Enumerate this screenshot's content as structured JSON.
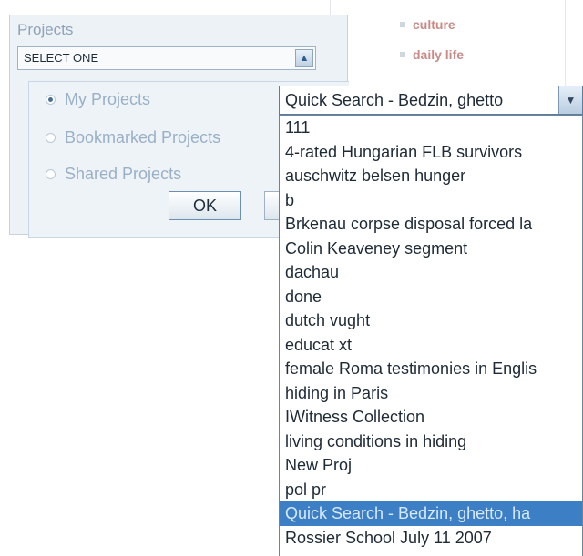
{
  "panel": {
    "title": "Projects",
    "select_label": "SELECT ONE",
    "radios": [
      {
        "label": "My Projects",
        "checked": true
      },
      {
        "label": "Bookmarked Projects",
        "checked": false
      },
      {
        "label": "Shared Projects",
        "checked": false
      }
    ],
    "ok_label": "OK"
  },
  "tags": [
    "culture",
    "daily life"
  ],
  "dropdown": {
    "selected": "Quick Search - Bedzin, ghetto",
    "options": [
      "111",
      "4-rated Hungarian FLB survivors",
      "auschwitz belsen hunger",
      "b",
      "Brkenau corpse disposal forced la",
      "Colin Keaveney segment",
      "dachau",
      "done",
      "dutch vught",
      "educat xt",
      "female Roma testimonies in Englis",
      "hiding in Paris",
      "IWitness Collection",
      "living conditions in hiding",
      "New Proj",
      "pol pr",
      "Quick Search - Bedzin, ghetto, ha",
      "Rossier School July 11 2007"
    ],
    "highlighted_index": 16
  },
  "colors": {
    "highlight": "#3d7fc4",
    "tag_text": "#c98b88",
    "panel_bg": "#edf2f7"
  }
}
